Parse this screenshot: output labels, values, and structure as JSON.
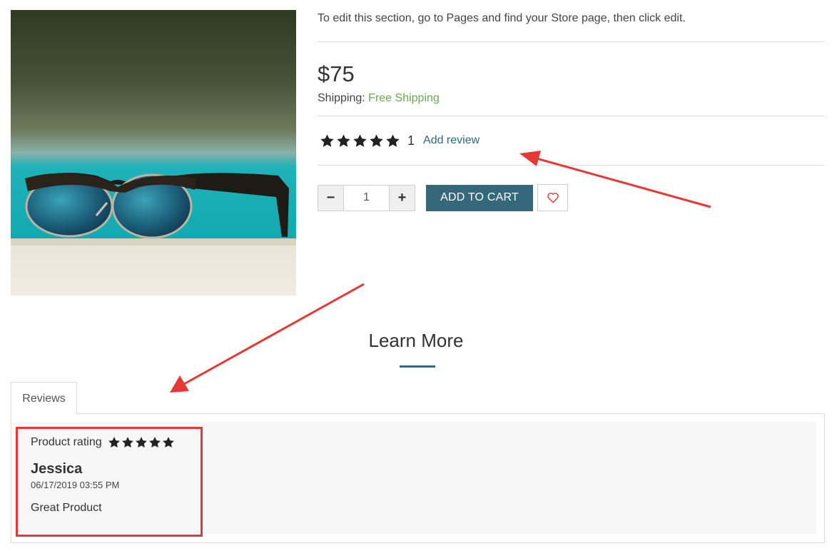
{
  "product": {
    "image_alt": "sunglasses-photo",
    "description": "To edit this section, go to Pages and find your Store page, then click edit.",
    "price": "$75",
    "shipping_label": "Shipping:",
    "shipping_value": "Free Shipping",
    "rating_stars": 5,
    "review_count": "1",
    "add_review_label": "Add review",
    "quantity": "1",
    "minus_label": "−",
    "plus_label": "+",
    "add_to_cart_label": "ADD TO CART"
  },
  "learn_more": {
    "title": "Learn More"
  },
  "tabs": [
    {
      "label": "Reviews"
    }
  ],
  "review": {
    "rating_label": "Product rating",
    "rating_stars": 5,
    "author": "Jessica",
    "date": "06/17/2019 03:55 PM",
    "text": "Great Product"
  },
  "colors": {
    "accent": "#34687a",
    "free_shipping": "#6aa84f",
    "link": "#2e6a85",
    "annotation": "#e53935"
  }
}
